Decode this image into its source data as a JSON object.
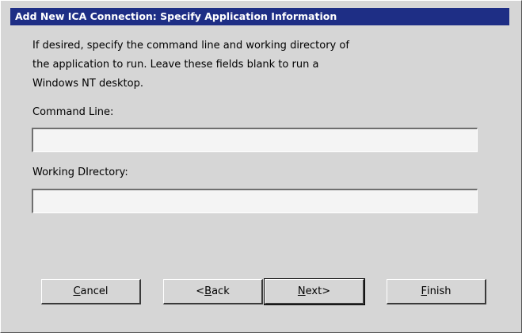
{
  "dialog": {
    "title": "Add New ICA Connection: Specify Application Information",
    "instructions": [
      "If desired, specify the command line and working directory of",
      "the application to run. Leave these fields blank to run a",
      "Windows NT desktop."
    ],
    "command_line": {
      "label": "Command Line:",
      "value": ""
    },
    "working_directory": {
      "label": "Working DIrectory:",
      "value": ""
    }
  },
  "buttons": {
    "cancel": {
      "mnemonic": "C",
      "rest": "ancel"
    },
    "back": {
      "prefix": "<",
      "mnemonic": "B",
      "rest": "ack"
    },
    "next": {
      "mnemonic": "N",
      "rest": "ext>"
    },
    "finish": {
      "mnemonic": "F",
      "rest": "inish"
    }
  },
  "colors": {
    "titlebar": "#1e2e85",
    "background": "#d6d6d6",
    "field_background": "#f4f4f4"
  }
}
